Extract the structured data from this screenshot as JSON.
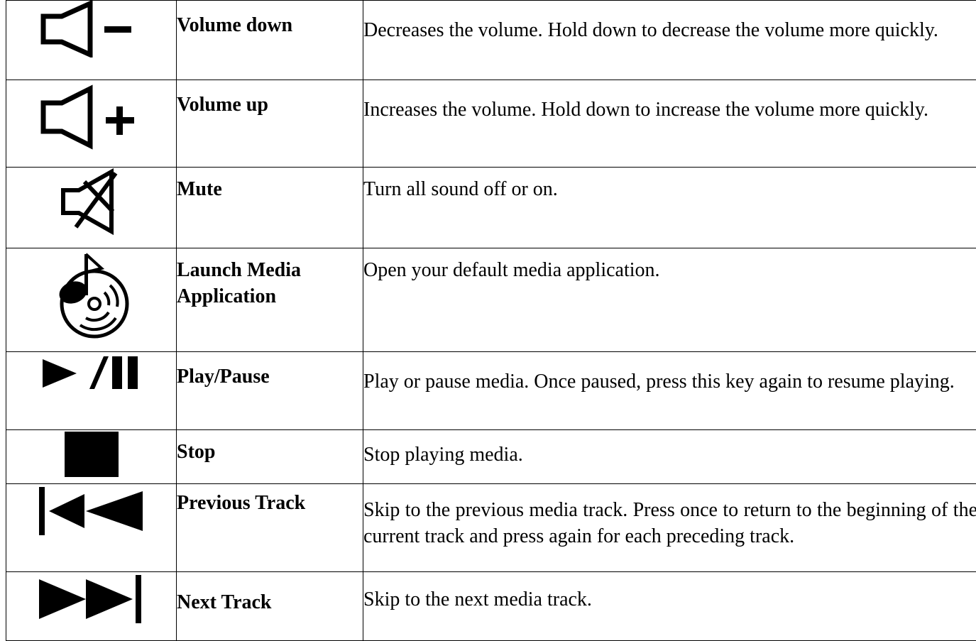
{
  "rows": [
    {
      "icon": "volume-down-icon",
      "name": "Volume down",
      "description": "Decreases the volume. Hold down to decrease the volume more quickly."
    },
    {
      "icon": "volume-up-icon",
      "name": "Volume up",
      "description": "Increases the volume. Hold down to increase the volume more quickly."
    },
    {
      "icon": "mute-icon",
      "name": "Mute",
      "description": "Turn all sound off or on."
    },
    {
      "icon": "media-disc-icon",
      "name": "Launch Media Application",
      "description": "Open your default media application."
    },
    {
      "icon": "play-pause-icon",
      "name": "Play/Pause",
      "description": "Play or pause media. Once paused, press this key again to resume playing."
    },
    {
      "icon": "stop-icon",
      "name": "Stop",
      "description": "Stop playing media."
    },
    {
      "icon": "previous-track-icon",
      "name": "Previous Track",
      "description": "Skip to the previous media track. Press once to return to the beginning of the current track and press again for each preceding track."
    },
    {
      "icon": "next-track-icon",
      "name": "Next Track",
      "description": "Skip to the next media track."
    }
  ]
}
